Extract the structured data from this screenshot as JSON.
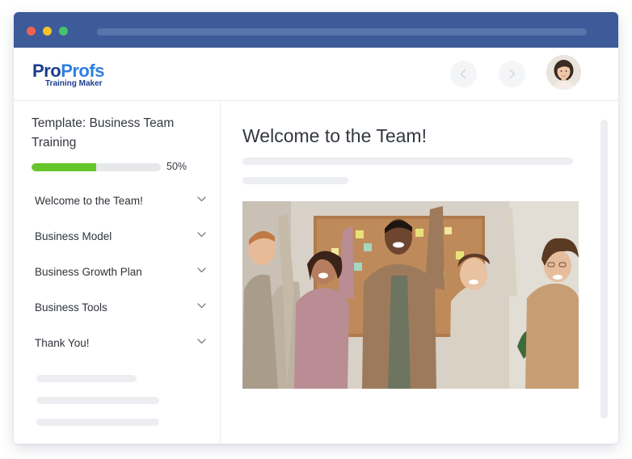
{
  "brand": {
    "logo_primary_a": "Pro",
    "logo_primary_b": "Profs",
    "logo_secondary": "Training Maker",
    "colors": {
      "titlebar": "#3d5a99",
      "logo_dark": "#1c3c8c",
      "logo_light": "#2f7fe0",
      "progress": "#66c52a"
    }
  },
  "window_controls": [
    "close-dot",
    "minimize-dot",
    "maximize-dot"
  ],
  "header": {
    "prev_icon": "chevron-left-icon",
    "next_icon": "chevron-right-icon",
    "avatar_icon": "user-avatar"
  },
  "sidebar": {
    "course_title": "Template: Business Team Training",
    "progress_label": "50%",
    "progress_value": 0.5,
    "items": [
      {
        "label": "Welcome to the Team!",
        "icon": "chevron-down-icon"
      },
      {
        "label": "Business Model",
        "icon": "chevron-down-icon"
      },
      {
        "label": "Business Growth Plan",
        "icon": "chevron-down-icon"
      },
      {
        "label": "Business Tools",
        "icon": "chevron-down-icon"
      },
      {
        "label": "Thank You!",
        "icon": "chevron-down-icon"
      }
    ]
  },
  "main": {
    "title": "Welcome to the Team!",
    "image": "team-celebrating-photo"
  }
}
